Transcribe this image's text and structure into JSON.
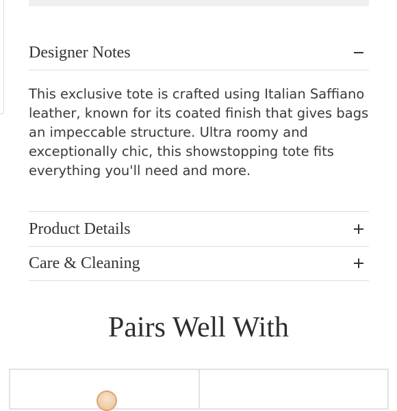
{
  "designer_notes": {
    "title": "Designer Notes",
    "toggle": "minus-icon",
    "body": "This exclusive tote is crafted using Italian Saffiano leather, known for its coated finish that gives bags an impeccable structure. Ultra roomy and exceptionally chic, this showstopping tote fits everything you'll need and more."
  },
  "product_details": {
    "title": "Product Details",
    "toggle": "plus-icon"
  },
  "care_cleaning": {
    "title": "Care & Cleaning",
    "toggle": "plus-icon"
  },
  "pairs_well_with": {
    "heading": "Pairs Well With"
  },
  "colors": {
    "text": "#333333",
    "divider": "#dcdcdc",
    "card_border": "#e2e2e2"
  }
}
